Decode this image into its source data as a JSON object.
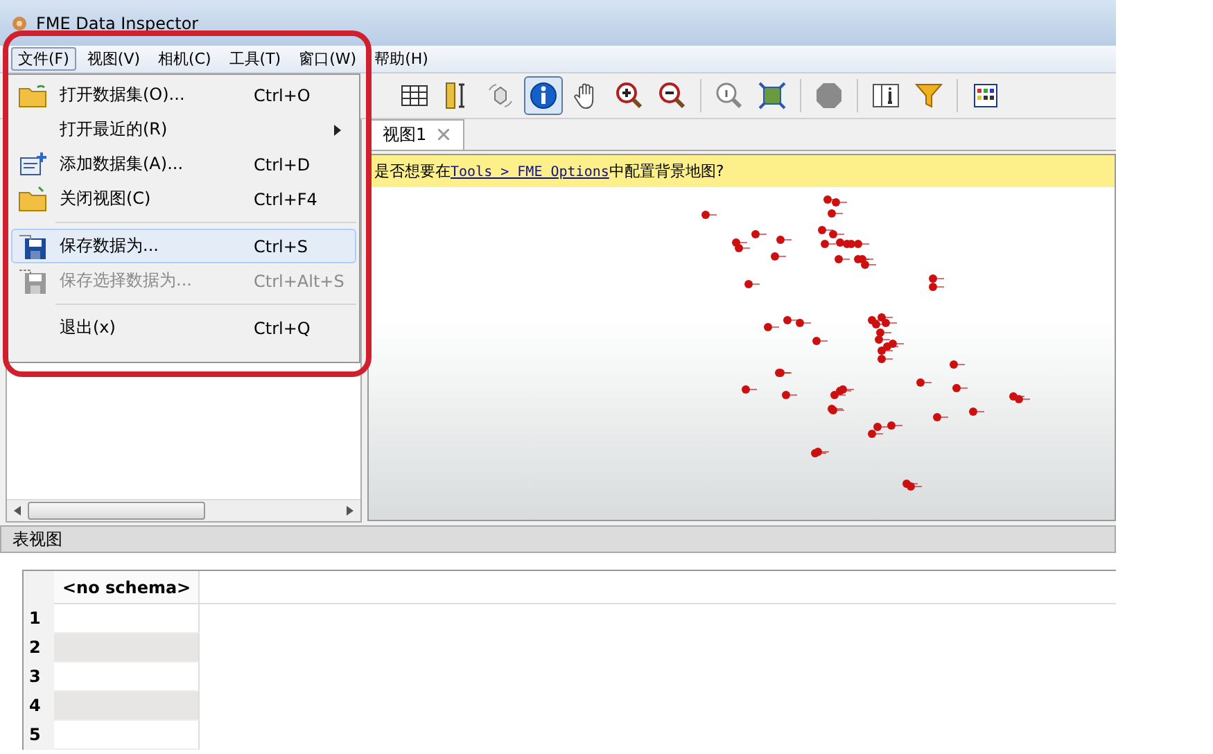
{
  "window": {
    "title": "FME Data Inspector"
  },
  "menu_bar": [
    {
      "label": "文件(F)",
      "selected": true
    },
    {
      "label": "视图(V)",
      "selected": false
    },
    {
      "label": "相机(C)",
      "selected": false
    },
    {
      "label": "工具(T)",
      "selected": false
    },
    {
      "label": "窗口(W)",
      "selected": false
    },
    {
      "label": "帮助(H)",
      "selected": false
    }
  ],
  "file_menu": [
    {
      "kind": "item",
      "label": "打开数据集(O)...",
      "shortcut": "Ctrl+O",
      "selected": false,
      "disabled": false
    },
    {
      "kind": "submenu",
      "label": "打开最近的(R)",
      "selected": false,
      "disabled": false
    },
    {
      "kind": "item",
      "label": "添加数据集(A)...",
      "shortcut": "Ctrl+D",
      "selected": false,
      "disabled": false
    },
    {
      "kind": "item",
      "label": "关闭视图(C)",
      "shortcut": "Ctrl+F4",
      "selected": false,
      "disabled": false
    },
    {
      "kind": "separator"
    },
    {
      "kind": "item",
      "label": "保存数据为...",
      "shortcut": "Ctrl+S",
      "selected": true,
      "disabled": false
    },
    {
      "kind": "item",
      "label": "保存选择数据为...",
      "shortcut": "Ctrl+Alt+S",
      "selected": false,
      "disabled": true
    },
    {
      "kind": "separator"
    },
    {
      "kind": "item",
      "label": "退出(x)",
      "shortcut": "Ctrl+Q",
      "selected": false,
      "disabled": false
    }
  ],
  "toolbar": [
    {
      "kind": "button",
      "selected": false
    },
    {
      "kind": "button",
      "selected": false
    },
    {
      "kind": "button",
      "selected": false
    },
    {
      "kind": "button",
      "selected": true
    },
    {
      "kind": "button",
      "selected": false
    },
    {
      "kind": "button",
      "selected": false
    },
    {
      "kind": "button",
      "selected": false
    },
    {
      "kind": "separator"
    },
    {
      "kind": "button",
      "selected": false
    },
    {
      "kind": "button",
      "selected": false
    },
    {
      "kind": "separator"
    },
    {
      "kind": "button",
      "selected": false
    },
    {
      "kind": "separator"
    },
    {
      "kind": "button",
      "selected": false
    },
    {
      "kind": "button",
      "selected": false
    },
    {
      "kind": "separator"
    },
    {
      "kind": "button",
      "selected": false
    }
  ],
  "view_tabs": [
    {
      "label": "视图1",
      "selected": true
    }
  ],
  "notice": {
    "before": "是否想要在",
    "link": "Tools > FME Options",
    "after": "中配置背景地图?"
  },
  "table_view": {
    "title": "表视图",
    "columns": [
      "<no schema>"
    ],
    "rows": [
      "1",
      "2",
      "3",
      "4",
      "5"
    ]
  }
}
